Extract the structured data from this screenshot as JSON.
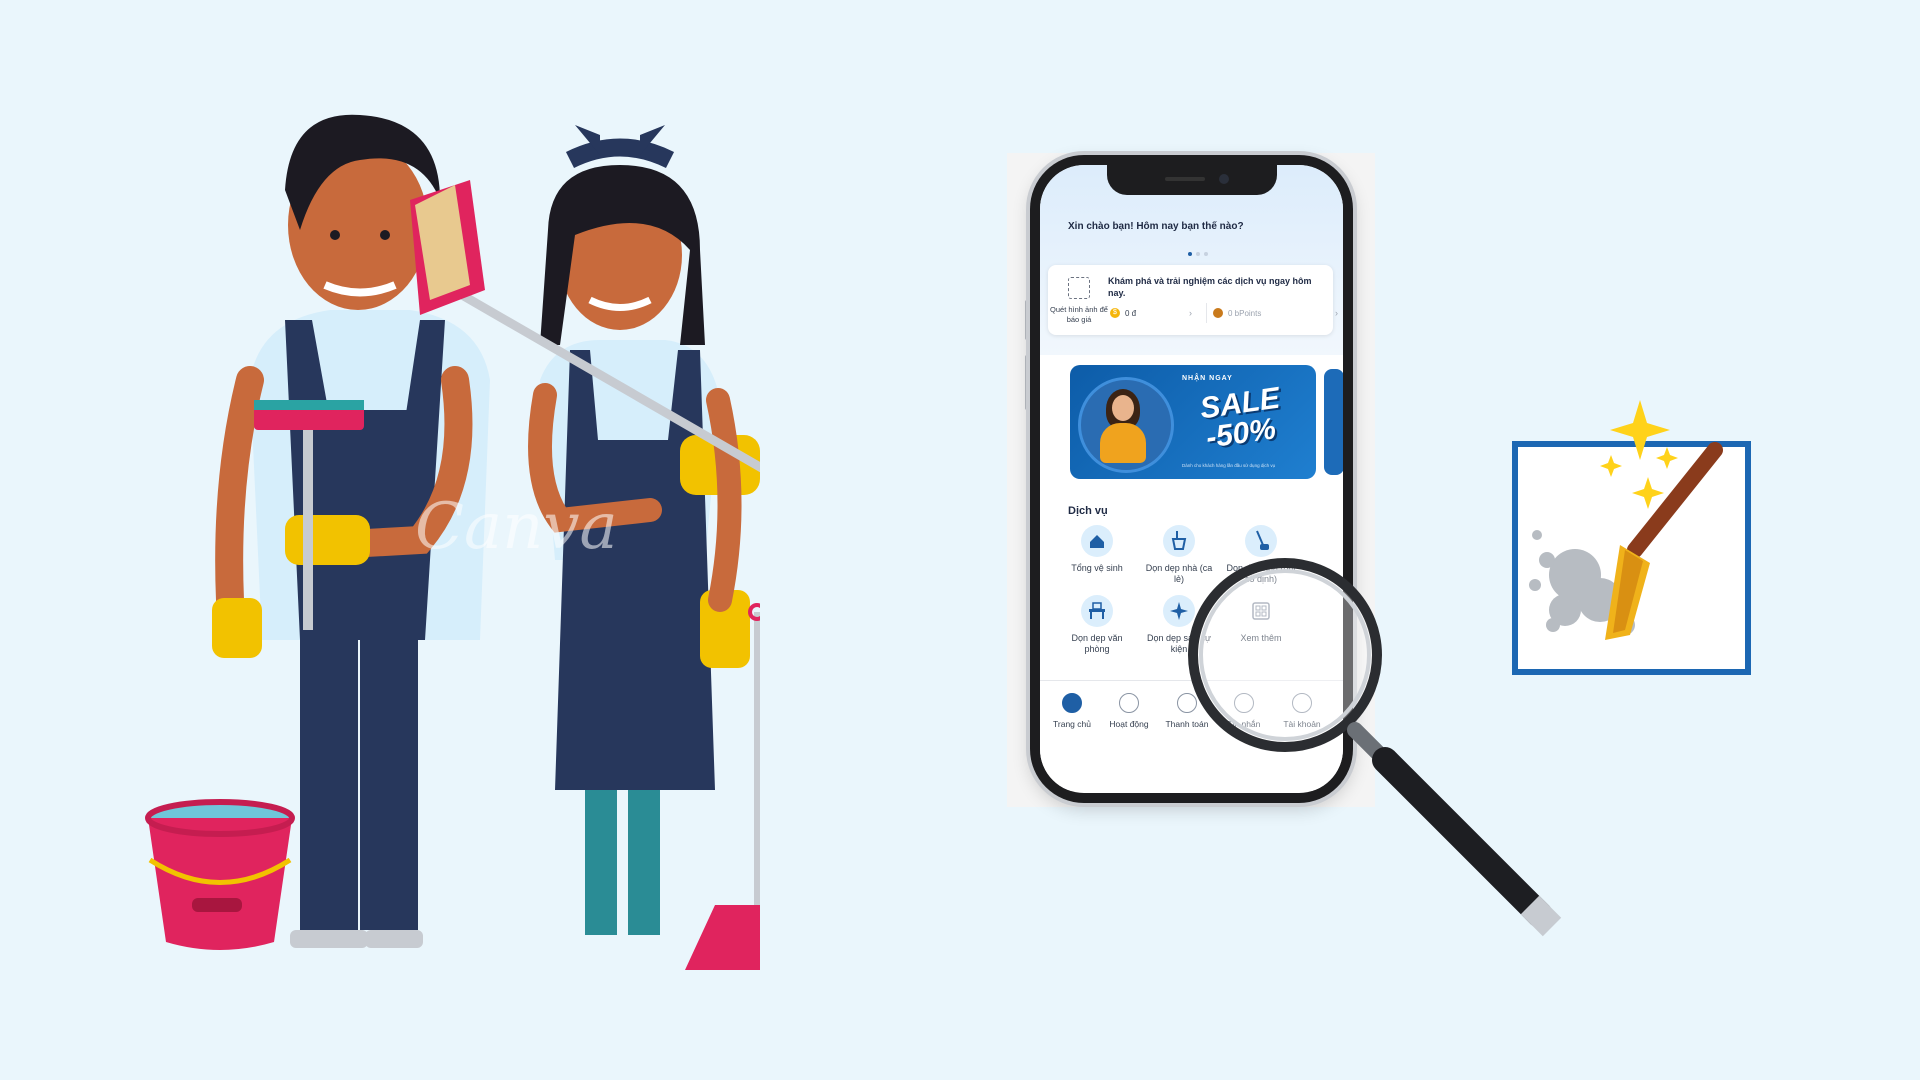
{
  "watermark": "Canva",
  "phone": {
    "greeting": "Xin chào bạn! Hôm nay bạn thế nào?",
    "explore_text": "Khám phá và trải nghiệm các dịch vụ ngay hôm nay.",
    "scan_label": "Quét hình ảnh để báo giá",
    "balance": "0 đ",
    "points": "0 bPoints",
    "promo": {
      "tag": "NHẬN NGAY",
      "sale": "SALE",
      "discount": "-50%",
      "footnote": "Dành cho khách hàng lần đầu sử dụng dịch vụ"
    },
    "section_title": "Dịch vụ",
    "services": [
      {
        "label": "Tổng vệ sinh",
        "icon": "house-cleaning-icon"
      },
      {
        "label": "Dọn dẹp nhà (ca lẻ)",
        "icon": "bucket-mop-icon"
      },
      {
        "label": "Dọn dẹp nhà (gói cố định)",
        "icon": "vacuum-icon"
      },
      {
        "label": "Dọn dẹp văn phòng",
        "icon": "office-desk-icon"
      },
      {
        "label": "Dọn dẹp sau sự kiện",
        "icon": "sparkle-icon"
      },
      {
        "label": "Xem thêm",
        "icon": "grid-icon"
      }
    ],
    "tabs": [
      {
        "label": "Trang chủ",
        "icon": "home-icon"
      },
      {
        "label": "Hoạt động",
        "icon": "list-icon"
      },
      {
        "label": "Thanh toán",
        "icon": "dollar-icon"
      },
      {
        "label": "Tin nhắn",
        "icon": "chat-icon"
      },
      {
        "label": "Tài khoản",
        "icon": "user-icon"
      }
    ]
  },
  "colors": {
    "background": "#eaf6fc",
    "accent": "#1f5fa5",
    "overall": "#27375c",
    "bucket": "#e0245e",
    "glove": "#f2c200"
  }
}
